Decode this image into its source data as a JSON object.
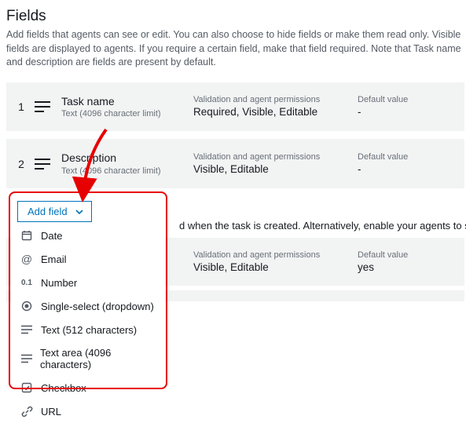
{
  "title": "Fields",
  "help": "Add fields that agents can see or edit. You can also choose to hide fields or make them read only. Visible fields are displayed to agents. If you require a certain field, make that field required. Note that Task name and description are fields are present by default.",
  "validation_header": "Validation and agent permissions",
  "default_header": "Default value",
  "rows": [
    {
      "num": "1",
      "name": "Task name",
      "sub": "Text (4096 character limit)",
      "valid": "Required, Visible, Editable",
      "def": "-"
    },
    {
      "num": "2",
      "name": "Description",
      "sub": "Text (4096 character limit)",
      "valid": "Visible, Editable",
      "def": "-"
    }
  ],
  "section2_text": "d when the task is created. Alternatively, enable your agents to select the Qu",
  "row3": {
    "valid": "Visible, Editable",
    "def": "yes"
  },
  "add_button": "Add field",
  "menu": [
    {
      "icon": "calendar-icon",
      "label": "Date"
    },
    {
      "icon": "at-icon",
      "label": "Email"
    },
    {
      "icon": "number-icon",
      "label": "Number"
    },
    {
      "icon": "radio-icon",
      "label": "Single-select (dropdown)"
    },
    {
      "icon": "text-icon",
      "label": "Text (512 characters)"
    },
    {
      "icon": "text-icon",
      "label": "Text area (4096 characters)"
    },
    {
      "icon": "checkbox-icon",
      "label": "Checkbox"
    },
    {
      "icon": "link-icon",
      "label": "URL"
    }
  ]
}
